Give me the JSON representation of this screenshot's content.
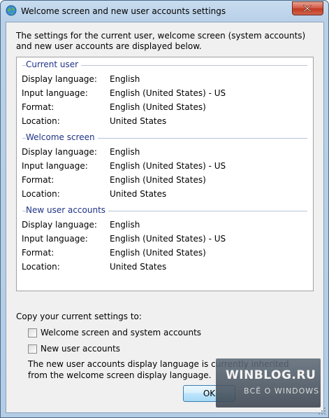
{
  "window": {
    "title": "Welcome screen and new user accounts settings",
    "close_icon": "close-icon",
    "title_icon": "globe-icon"
  },
  "intro": "The settings for the current user, welcome screen (system accounts) and new user accounts are displayed below.",
  "sections": [
    {
      "heading": "Current user",
      "rows": [
        {
          "label": "Display language:",
          "value": "English"
        },
        {
          "label": "Input language:",
          "value": "English (United States) - US"
        },
        {
          "label": "Format:",
          "value": "English (United States)"
        },
        {
          "label": "Location:",
          "value": "United States"
        }
      ]
    },
    {
      "heading": "Welcome screen",
      "rows": [
        {
          "label": "Display language:",
          "value": "English"
        },
        {
          "label": "Input language:",
          "value": "English (United States) - US"
        },
        {
          "label": "Format:",
          "value": "English (United States)"
        },
        {
          "label": "Location:",
          "value": "United States"
        }
      ]
    },
    {
      "heading": "New user accounts",
      "rows": [
        {
          "label": "Display language:",
          "value": "English"
        },
        {
          "label": "Input language:",
          "value": "English (United States) - US"
        },
        {
          "label": "Format:",
          "value": "English (United States)"
        },
        {
          "label": "Location:",
          "value": "United States"
        }
      ]
    }
  ],
  "copy": {
    "label": "Copy your current settings to:",
    "options": [
      {
        "label": "Welcome screen and system accounts",
        "checked": false
      },
      {
        "label": "New user accounts",
        "checked": false
      }
    ],
    "note": "The new user accounts display language is currently inherited from the welcome screen display language."
  },
  "buttons": {
    "ok": "OK"
  },
  "watermark": {
    "site": "WINBLOG.RU",
    "tagline": "ВСЁ О WINDOWS"
  }
}
